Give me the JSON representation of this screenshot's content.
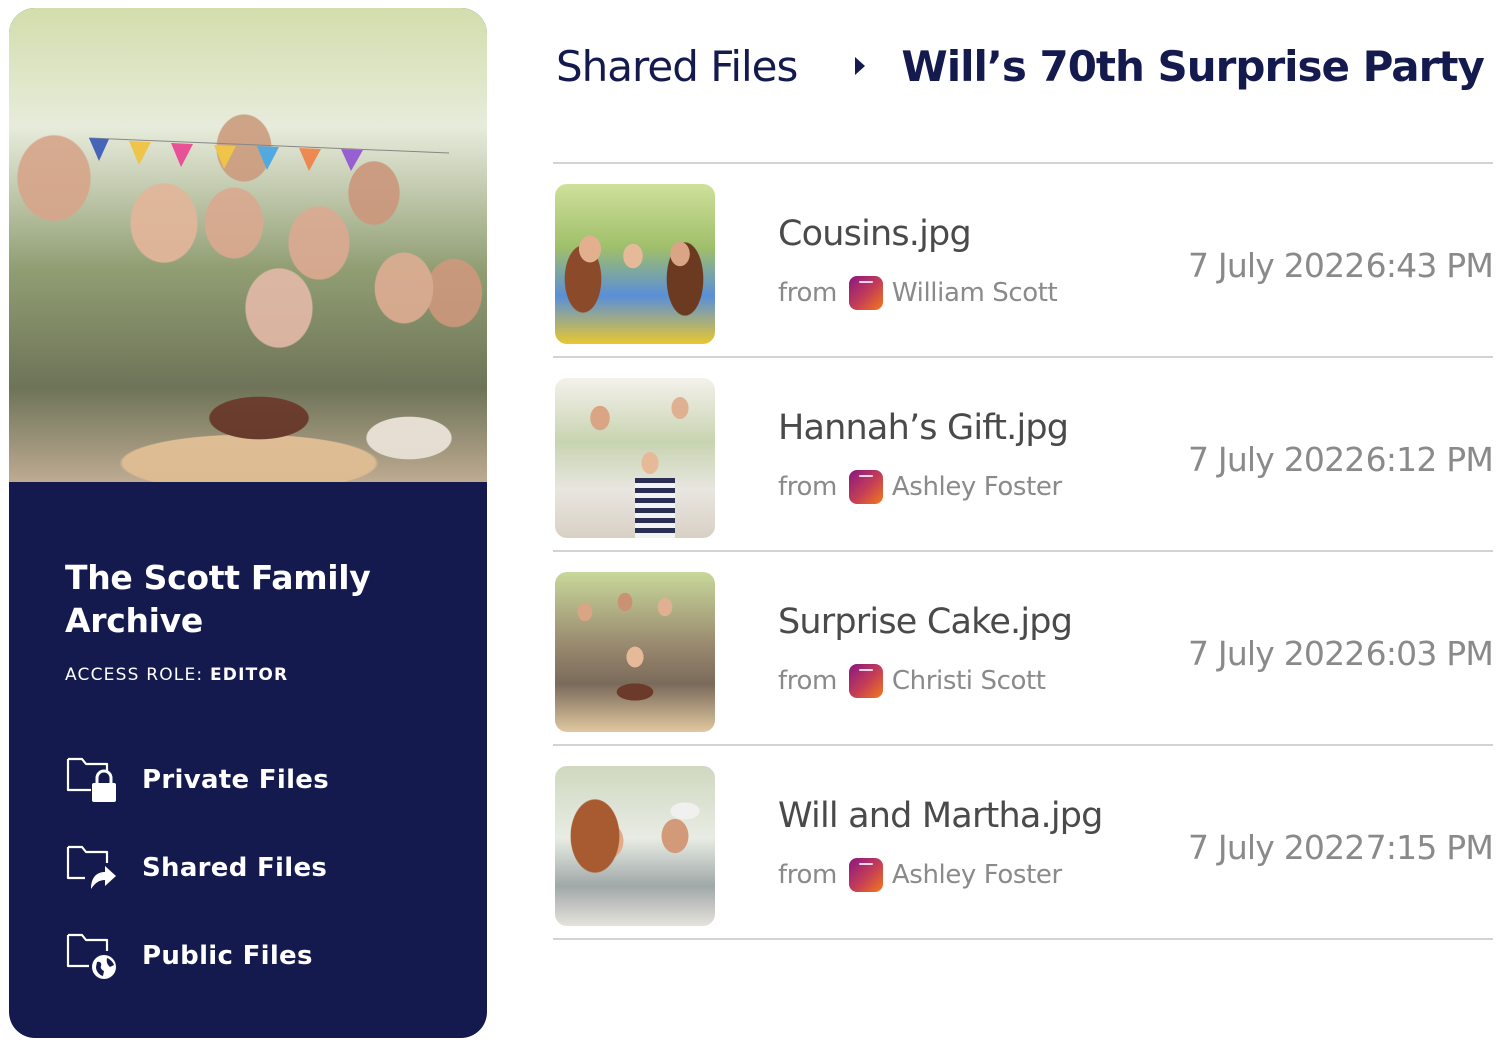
{
  "sidebar": {
    "archive_title": "The Scott Family Archive",
    "access_role_label": "ACCESS ROLE:",
    "access_role_value": "EDITOR",
    "hero_image": "family-party-photo",
    "nav": [
      {
        "label": "Private Files",
        "icon": "folder-lock-icon"
      },
      {
        "label": "Shared Files",
        "icon": "folder-share-icon"
      },
      {
        "label": "Public Files",
        "icon": "folder-globe-icon"
      }
    ],
    "colors": {
      "background": "#141a4d",
      "text": "#ffffff"
    }
  },
  "breadcrumb": {
    "root": "Shared Files",
    "separator_icon": "caret-right-icon",
    "current": "Will’s 70th Surprise Party"
  },
  "files": [
    {
      "name": "Cousins.jpg",
      "from_label": "from",
      "sender": "William Scott",
      "date": "7 July 2022",
      "time": "6:43 PM",
      "thumb": "three-women-toasting"
    },
    {
      "name": "Hannah’s Gift.jpg",
      "from_label": "from",
      "sender": "Ashley Foster",
      "date": "7 July 2022",
      "time": "6:12 PM",
      "thumb": "girl-receiving-gift"
    },
    {
      "name": "Surprise Cake.jpg",
      "from_label": "from",
      "sender": "Christi Scott",
      "date": "7 July 2022",
      "time": "6:03 PM",
      "thumb": "family-with-cake"
    },
    {
      "name": "Will and Martha.jpg",
      "from_label": "from",
      "sender": "Ashley Foster",
      "date": "7 July 2022",
      "time": "7:15 PM",
      "thumb": "elderly-couple"
    }
  ],
  "colors": {
    "accent": "#141a4d",
    "divider": "#d3d3d3",
    "muted_text": "#8a8a8a",
    "file_name_text": "#4a4a4a",
    "user_icon_gradient": [
      "#8a1682",
      "#f47a1a"
    ]
  }
}
